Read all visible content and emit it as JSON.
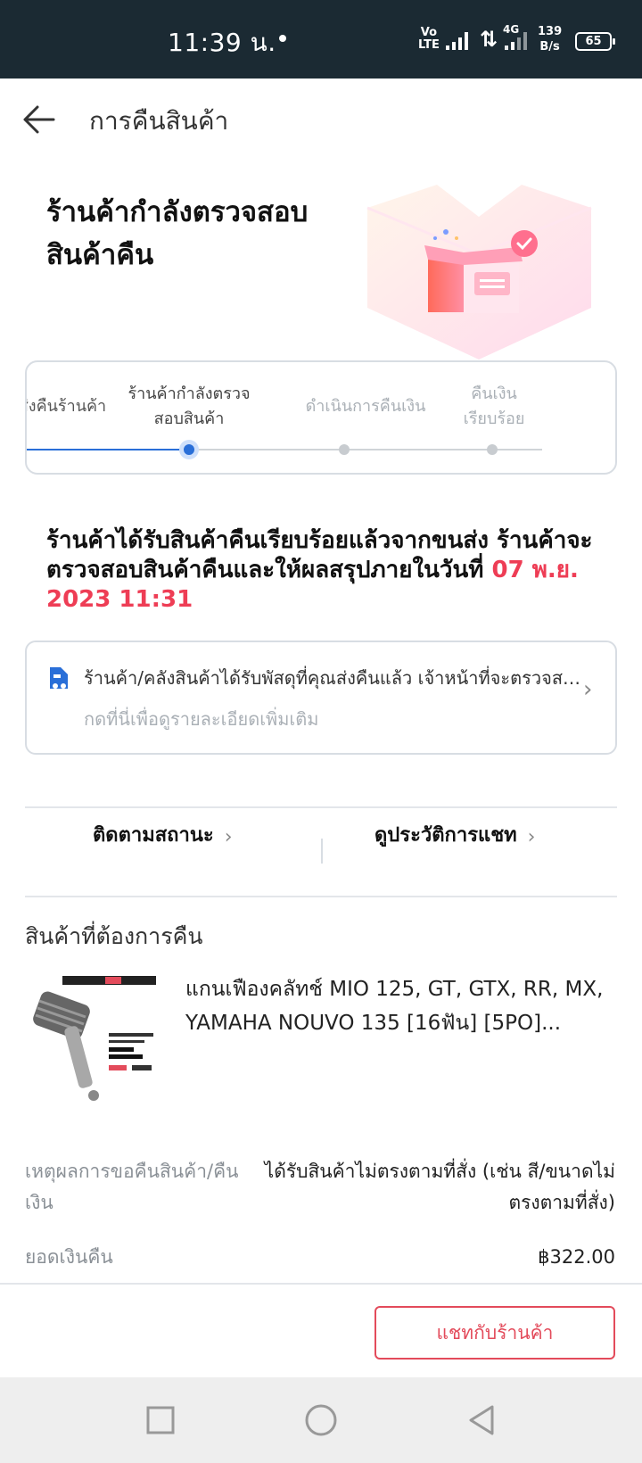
{
  "status_bar": {
    "time": "11:39 น.",
    "network_top": "Vo",
    "network_bottom": "LTE",
    "data_arrows": "⇅",
    "network_gen": "4G",
    "speed_value": "139",
    "speed_unit": "B/s",
    "battery": "65"
  },
  "header": {
    "title": "การคืนสินค้า",
    "back_icon": "arrow-left-icon"
  },
  "hero": {
    "title_line1": "ร้านค้ากำลังตรวจสอบ",
    "title_line2": "สินค้าคืน"
  },
  "stepper": {
    "steps": [
      {
        "label_line1": "ส่งคืนร้านค้า",
        "label_line2": "",
        "state": "done"
      },
      {
        "label_line1": "ร้านค้ากำลังตรวจ",
        "label_line2": "สอบสินค้า",
        "state": "active"
      },
      {
        "label_line1": "ดำเนินการคืนเงิน",
        "label_line2": "",
        "state": "todo"
      },
      {
        "label_line1": "คืนเงิน",
        "label_line2": "เรียบร้อย",
        "state": "todo"
      }
    ],
    "active_color": "#2a6fd8",
    "inactive_color": "#c8ccd0"
  },
  "message": {
    "text": "ร้านค้าได้รับสินค้าคืนเรียบร้อยแล้วจากขนส่ง ร้านค้าจะตรวจสอบสินค้าคืนและให้ผลสรุปภายในวันที่",
    "deadline": "07 พ.ย. 2023 11:31",
    "highlight_color": "#ee3d55"
  },
  "info_card": {
    "icon": "delivery-truck-icon",
    "text": "ร้านค้า/คลังสินค้าได้รับพัสดุที่คุณส่งคืนแล้ว เจ้าหน้าที่จะตรวจสอบสินค้าคืน",
    "sub": "กดที่นี่เพื่อดูรายละเอียดเพิ่มเติม"
  },
  "actions": {
    "track": "ติดตามสถานะ",
    "chat_history": "ดูประวัติการแชท"
  },
  "product_section": {
    "title": "สินค้าที่ต้องการคืน",
    "product_name": "แกนเฟืองคลัทช์ MIO 125, GT, GTX, RR, MX, YAMAHA NOUVO 135 [16ฟัน] [5PO]..."
  },
  "details": {
    "reason_label_line1": "เหตุผลการขอคืนสินค้า/คืน",
    "reason_label_line2": "เงิน",
    "reason_value_line1": "ได้รับสินค้าไม่ตรงตามที่สั่ง (เช่น สี/ขนาดไม่",
    "reason_value_line2": "ตรงตามที่สั่ง)",
    "refund_label": "ยอดเงินคืน",
    "refund_value": "฿322.00"
  },
  "footer": {
    "chat_button": "แชทกับร้านค้า",
    "accent": "#e34b5b"
  },
  "nav_bar": {
    "buttons": [
      "recent-apps-icon",
      "home-icon",
      "back-icon"
    ]
  }
}
